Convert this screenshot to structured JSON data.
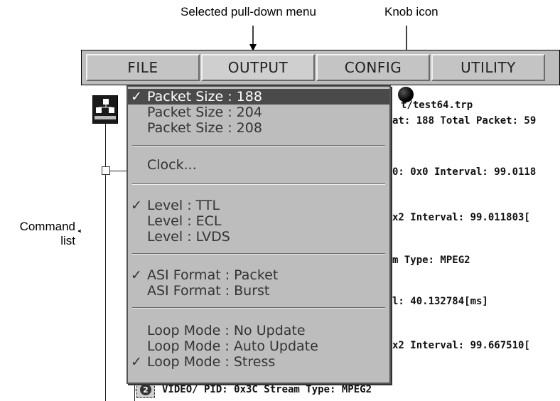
{
  "callouts": {
    "pulldown": "Selected pull-down menu",
    "knob": "Knob icon",
    "command_list_line1": "Command",
    "command_list_line2": "list"
  },
  "menubar": {
    "tabs": [
      "FILE",
      "OUTPUT",
      "CONFIG",
      "UTILITY"
    ],
    "selected": "OUTPUT"
  },
  "pulldown": {
    "items": [
      {
        "label": "Packet Size : 188",
        "checked": true,
        "highlight": true
      },
      {
        "label": "Packet Size : 204",
        "checked": false
      },
      {
        "label": "Packet Size : 208",
        "checked": false
      },
      {
        "label": "Clock...",
        "checked": false
      },
      {
        "label": "Level : TTL",
        "checked": true
      },
      {
        "label": "Level : ECL",
        "checked": false
      },
      {
        "label": "Level : LVDS",
        "checked": false
      },
      {
        "label": "ASI Format : Packet",
        "checked": true
      },
      {
        "label": "ASI Format : Burst",
        "checked": false
      },
      {
        "label": "Loop Mode : No Update",
        "checked": false
      },
      {
        "label": "Loop Mode : Auto Update",
        "checked": false
      },
      {
        "label": "Loop Mode : Stress",
        "checked": true
      }
    ],
    "check_glyph": "✓"
  },
  "tree": {
    "file_path": "/test64.trp",
    "file_path_prefix": "t",
    "file_info": "at: 188  Total Packet: 59",
    "row1": "0: 0x0  Interval: 99.0118",
    "row2": "x2  Interval: 99.011803[",
    "row3": "m Type: MPEG2",
    "row4": "l: 40.132784[ms]",
    "row5": "x2  Interval: 99.667510[",
    "row6": "VIDEO/  PID: 0x3C  Stream Type: MPEG2",
    "badge_number": "2"
  },
  "icons": {
    "knob": "knob-icon",
    "network": "network-tree-icon",
    "expand": "expand-box-icon",
    "stream": "stream-badge-icon"
  }
}
